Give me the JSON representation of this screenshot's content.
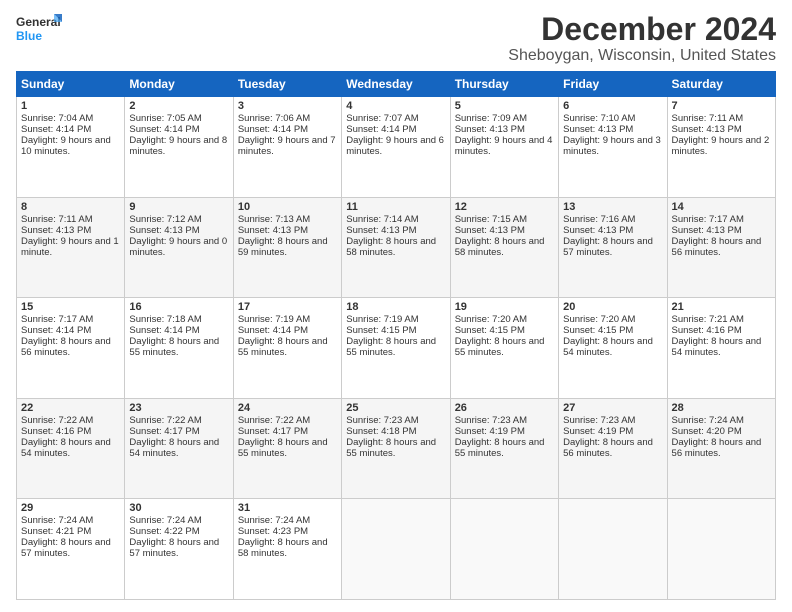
{
  "logo": {
    "line1": "General",
    "line2": "Blue"
  },
  "title": "December 2024",
  "subtitle": "Sheboygan, Wisconsin, United States",
  "days": [
    "Sunday",
    "Monday",
    "Tuesday",
    "Wednesday",
    "Thursday",
    "Friday",
    "Saturday"
  ],
  "weeks": [
    [
      {
        "day": 1,
        "sunrise": "7:04 AM",
        "sunset": "4:14 PM",
        "daylight": "9 hours and 10 minutes."
      },
      {
        "day": 2,
        "sunrise": "7:05 AM",
        "sunset": "4:14 PM",
        "daylight": "9 hours and 8 minutes."
      },
      {
        "day": 3,
        "sunrise": "7:06 AM",
        "sunset": "4:14 PM",
        "daylight": "9 hours and 7 minutes."
      },
      {
        "day": 4,
        "sunrise": "7:07 AM",
        "sunset": "4:14 PM",
        "daylight": "9 hours and 6 minutes."
      },
      {
        "day": 5,
        "sunrise": "7:09 AM",
        "sunset": "4:13 PM",
        "daylight": "9 hours and 4 minutes."
      },
      {
        "day": 6,
        "sunrise": "7:10 AM",
        "sunset": "4:13 PM",
        "daylight": "9 hours and 3 minutes."
      },
      {
        "day": 7,
        "sunrise": "7:11 AM",
        "sunset": "4:13 PM",
        "daylight": "9 hours and 2 minutes."
      }
    ],
    [
      {
        "day": 8,
        "sunrise": "7:11 AM",
        "sunset": "4:13 PM",
        "daylight": "9 hours and 1 minute."
      },
      {
        "day": 9,
        "sunrise": "7:12 AM",
        "sunset": "4:13 PM",
        "daylight": "9 hours and 0 minutes."
      },
      {
        "day": 10,
        "sunrise": "7:13 AM",
        "sunset": "4:13 PM",
        "daylight": "8 hours and 59 minutes."
      },
      {
        "day": 11,
        "sunrise": "7:14 AM",
        "sunset": "4:13 PM",
        "daylight": "8 hours and 58 minutes."
      },
      {
        "day": 12,
        "sunrise": "7:15 AM",
        "sunset": "4:13 PM",
        "daylight": "8 hours and 58 minutes."
      },
      {
        "day": 13,
        "sunrise": "7:16 AM",
        "sunset": "4:13 PM",
        "daylight": "8 hours and 57 minutes."
      },
      {
        "day": 14,
        "sunrise": "7:17 AM",
        "sunset": "4:13 PM",
        "daylight": "8 hours and 56 minutes."
      }
    ],
    [
      {
        "day": 15,
        "sunrise": "7:17 AM",
        "sunset": "4:14 PM",
        "daylight": "8 hours and 56 minutes."
      },
      {
        "day": 16,
        "sunrise": "7:18 AM",
        "sunset": "4:14 PM",
        "daylight": "8 hours and 55 minutes."
      },
      {
        "day": 17,
        "sunrise": "7:19 AM",
        "sunset": "4:14 PM",
        "daylight": "8 hours and 55 minutes."
      },
      {
        "day": 18,
        "sunrise": "7:19 AM",
        "sunset": "4:15 PM",
        "daylight": "8 hours and 55 minutes."
      },
      {
        "day": 19,
        "sunrise": "7:20 AM",
        "sunset": "4:15 PM",
        "daylight": "8 hours and 55 minutes."
      },
      {
        "day": 20,
        "sunrise": "7:20 AM",
        "sunset": "4:15 PM",
        "daylight": "8 hours and 54 minutes."
      },
      {
        "day": 21,
        "sunrise": "7:21 AM",
        "sunset": "4:16 PM",
        "daylight": "8 hours and 54 minutes."
      }
    ],
    [
      {
        "day": 22,
        "sunrise": "7:22 AM",
        "sunset": "4:16 PM",
        "daylight": "8 hours and 54 minutes."
      },
      {
        "day": 23,
        "sunrise": "7:22 AM",
        "sunset": "4:17 PM",
        "daylight": "8 hours and 54 minutes."
      },
      {
        "day": 24,
        "sunrise": "7:22 AM",
        "sunset": "4:17 PM",
        "daylight": "8 hours and 55 minutes."
      },
      {
        "day": 25,
        "sunrise": "7:23 AM",
        "sunset": "4:18 PM",
        "daylight": "8 hours and 55 minutes."
      },
      {
        "day": 26,
        "sunrise": "7:23 AM",
        "sunset": "4:19 PM",
        "daylight": "8 hours and 55 minutes."
      },
      {
        "day": 27,
        "sunrise": "7:23 AM",
        "sunset": "4:19 PM",
        "daylight": "8 hours and 56 minutes."
      },
      {
        "day": 28,
        "sunrise": "7:24 AM",
        "sunset": "4:20 PM",
        "daylight": "8 hours and 56 minutes."
      }
    ],
    [
      {
        "day": 29,
        "sunrise": "7:24 AM",
        "sunset": "4:21 PM",
        "daylight": "8 hours and 57 minutes."
      },
      {
        "day": 30,
        "sunrise": "7:24 AM",
        "sunset": "4:22 PM",
        "daylight": "8 hours and 57 minutes."
      },
      {
        "day": 31,
        "sunrise": "7:24 AM",
        "sunset": "4:23 PM",
        "daylight": "8 hours and 58 minutes."
      },
      null,
      null,
      null,
      null
    ]
  ]
}
